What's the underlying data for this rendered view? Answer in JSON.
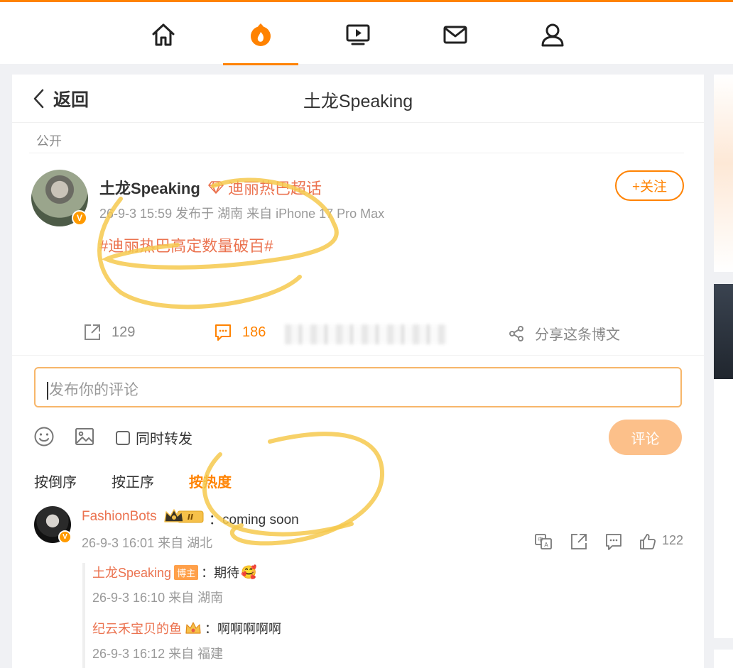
{
  "nav": {
    "items": [
      {
        "name": "home",
        "icon": "home-icon"
      },
      {
        "name": "hot",
        "icon": "fire-icon",
        "active": true
      },
      {
        "name": "video",
        "icon": "video-icon"
      },
      {
        "name": "messages",
        "icon": "mail-icon"
      },
      {
        "name": "profile",
        "icon": "user-icon"
      }
    ],
    "accent": "#ff8200"
  },
  "header": {
    "back_label": "返回",
    "title": "土龙Speaking"
  },
  "post": {
    "visibility": "公开",
    "author": "土龙Speaking",
    "supertopic": "迪丽热巴超话",
    "meta": "26-9-3 15:59  发布于 湖南  来自 iPhone 17 Pro Max",
    "follow_label": "+关注",
    "text": "#迪丽热巴高定数量破百#",
    "reposts": "129",
    "comments": "186",
    "share_label": "分享这条博文"
  },
  "composer": {
    "placeholder": "发布你的评论",
    "repost_label": "同时转发",
    "submit_label": "评论"
  },
  "sort_tabs": [
    {
      "label": "按倒序"
    },
    {
      "label": "按正序"
    },
    {
      "label": "按热度",
      "active": true
    }
  ],
  "comment": {
    "author": "FashionBots",
    "badge_level": "II",
    "text": "：coming soon",
    "meta": "26-9-3 16:01  来自 湖北",
    "likes": "122",
    "replies": [
      {
        "author": "土龙Speaking",
        "badge": "博主",
        "text": "：期待",
        "emoji": "🥰",
        "meta": "26-9-3 16:10  来自 湖南"
      },
      {
        "author": "纪云禾宝贝的鱼",
        "text": "：啊啊啊啊啊",
        "meta": "26-9-3 16:12  来自 福建"
      }
    ]
  }
}
